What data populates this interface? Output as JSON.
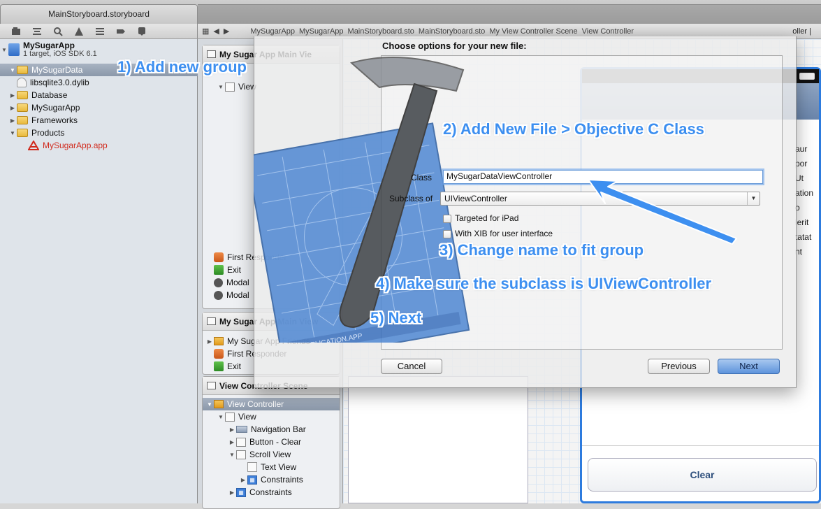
{
  "window": {
    "tab_title": "MainStoryboard.storyboard"
  },
  "jumpbar": {
    "items": [
      "MySugarApp",
      "MySugarApp",
      "MainStoryboard.sto",
      "MainStoryboard.sto",
      "My View Controller Scene",
      "View Controller"
    ],
    "right_text": "oller |"
  },
  "navigator": {
    "project_name": "MySugarApp",
    "project_subtitle": "1 target, iOS SDK 6.1",
    "items": [
      {
        "label": "MySugarData"
      },
      {
        "label": "libsqlite3.0.dylib"
      },
      {
        "label": "Database"
      },
      {
        "label": "MySugarApp"
      },
      {
        "label": "Frameworks"
      },
      {
        "label": "Products"
      },
      {
        "label": "MySugarApp.app"
      }
    ]
  },
  "outline": {
    "scene1_title": "My Sugar App Main Vie",
    "scene1_rows": [
      "View",
      "First Responder",
      "Exit",
      "Modal",
      "Modal"
    ],
    "scene2_title": "My Sugar App Main View",
    "scene2_rows": [
      "My Sugar App Friends",
      "First Responder",
      "Exit"
    ],
    "scene3_title": "View Controller Scene",
    "scene3_rows": [
      "View Controller",
      "View",
      "Navigation Bar",
      "Button - Clear",
      "Scroll View",
      "Text View",
      "Constraints",
      "Constraints"
    ]
  },
  "iphone": {
    "latin_lines": [
      "aur",
      "por",
      "Ut",
      "ation",
      "o",
      "lerit",
      "",
      "tatat",
      "nt"
    ],
    "clear_label": "Clear"
  },
  "dialog": {
    "title": "Choose options for your new file:",
    "class_label": "Class",
    "class_value": "MySugarDataViewController",
    "subclass_label": "Subclass of",
    "subclass_value": "UIViewController",
    "targeted_ipad": "Targeted for iPad",
    "with_xib": "With XIB for user interface",
    "cancel": "Cancel",
    "previous": "Previous",
    "next": "Next",
    "art_caption": "APPLICATION.APP"
  },
  "annotations": {
    "a1": "1) Add new group",
    "a2": "2) Add New File > Objective C Class",
    "a3": "3) Change name to fit group",
    "a4": "4) Make sure the subclass is UIViewController",
    "a5": "5) Next"
  },
  "colors": {
    "annotation": "#3d8ff0",
    "selection": "#8b98aa",
    "accent_blue": "#2d7bde"
  }
}
